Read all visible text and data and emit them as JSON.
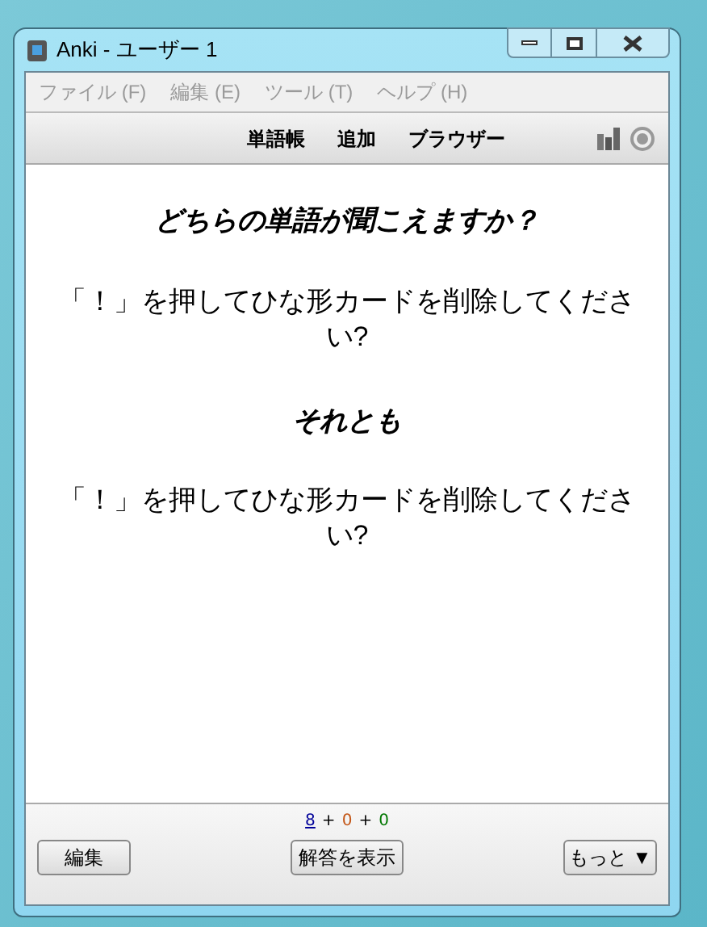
{
  "window": {
    "title": "Anki - ユーザー 1"
  },
  "menu": [
    {
      "label": "ファイル (F)",
      "disabled": true
    },
    {
      "label": "編集 (E)",
      "disabled": true
    },
    {
      "label": "ツール (T)",
      "disabled": true
    },
    {
      "label": "ヘルプ (H)",
      "disabled": true
    }
  ],
  "toolbar": [
    "単語帳",
    "追加",
    "ブラウザー"
  ],
  "card": [
    {
      "kind": "prompt",
      "text": "どちらの単語が聞こえますか？"
    },
    {
      "kind": "answer",
      "text": "「！」を押してひな形カードを削除してください?"
    },
    {
      "kind": "prompt",
      "text": "それとも"
    },
    {
      "kind": "answer",
      "text": "「！」を押してひな形カードを削除してください?"
    }
  ],
  "counts": [
    {
      "text": "8",
      "color": "#000099",
      "current": true
    },
    {
      "text": "0",
      "color": "#c35617",
      "current": false
    },
    {
      "text": "0",
      "color": "#007700",
      "current": false
    }
  ],
  "count_separator": "+",
  "buttons": {
    "edit": "編集",
    "show_answer": "解答を表示",
    "more": "もっと ▼"
  }
}
